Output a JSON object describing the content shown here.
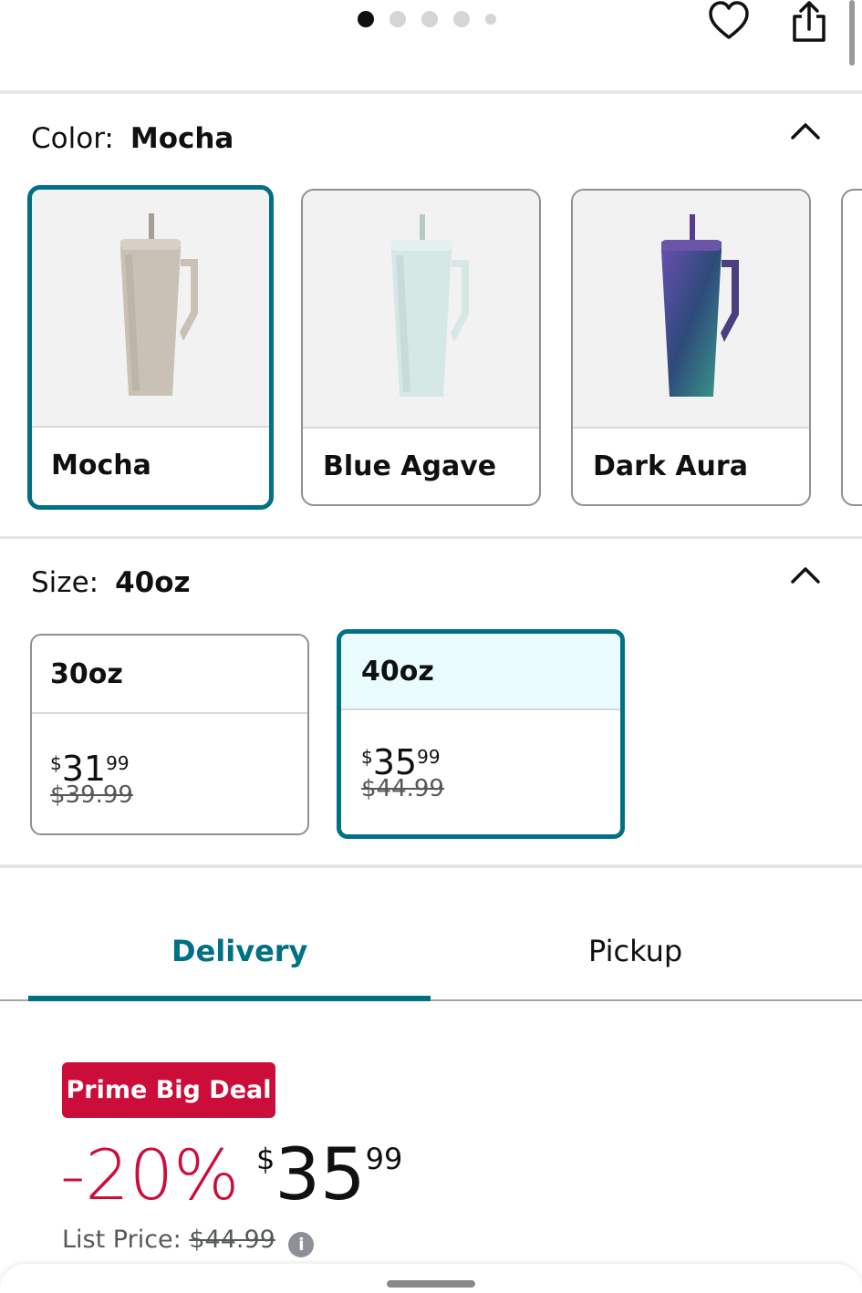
{
  "carousel": {
    "page_count": 5,
    "active_index": 0
  },
  "header_icons": [
    "heart-icon",
    "share-icon"
  ],
  "color_section": {
    "label": "Color:",
    "selected": "Mocha",
    "options": [
      {
        "name": "Mocha",
        "tumbler_color": "#c9c1b6",
        "selected": true
      },
      {
        "name": "Blue Agave",
        "tumbler_color": "#d6e8e6",
        "selected": false
      },
      {
        "name": "Dark Aura",
        "tumbler_color": "#4b3f7d",
        "selected": false
      }
    ]
  },
  "size_section": {
    "label": "Size:",
    "selected": "40oz",
    "options": [
      {
        "name": "30oz",
        "price_symbol": "$",
        "price_whole": "31",
        "price_fraction": "99",
        "was_price": "$39.99",
        "selected": false
      },
      {
        "name": "40oz",
        "price_symbol": "$",
        "price_whole": "35",
        "price_fraction": "99",
        "was_price": "$44.99",
        "selected": true
      }
    ]
  },
  "tabs": {
    "delivery": "Delivery",
    "pickup": "Pickup",
    "active": "Delivery"
  },
  "deal": {
    "badge": "Prime Big Deal",
    "discount": "-20%",
    "price_symbol": "$",
    "price_whole": "35",
    "price_fraction": "99",
    "list_price_label": "List Price:",
    "list_price": "$44.99"
  },
  "colors": {
    "accent": "#007185",
    "deal_red": "#cc0c39",
    "selected_bg": "#e9fbfd"
  }
}
